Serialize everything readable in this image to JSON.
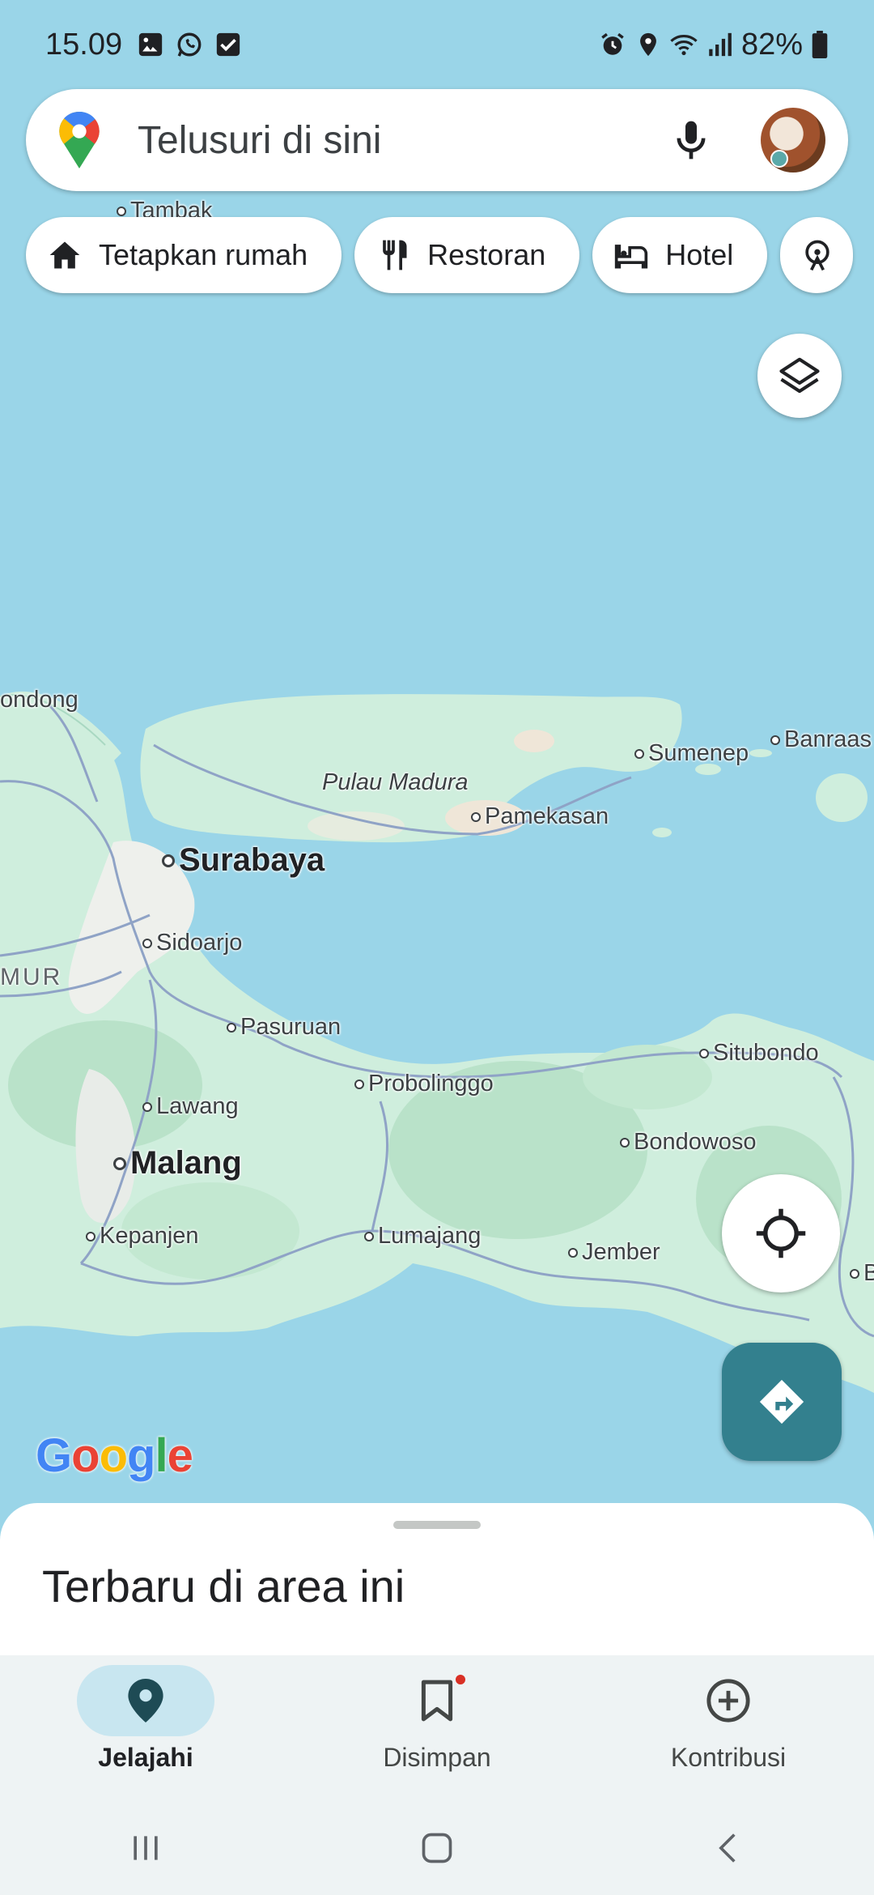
{
  "status_bar": {
    "time": "15.09",
    "battery": "82%",
    "icons": [
      "gallery-icon",
      "whatsapp-icon",
      "checkbox-icon",
      "alarm-icon",
      "location-icon",
      "wifi-icon",
      "signal-icon",
      "battery-icon"
    ]
  },
  "search": {
    "placeholder": "Telusuri di sini"
  },
  "chips": [
    {
      "label": "Tetapkan rumah",
      "icon": "home-icon"
    },
    {
      "label": "Restoran",
      "icon": "restaurant-icon"
    },
    {
      "label": "Hotel",
      "icon": "hotel-icon"
    },
    {
      "label": "",
      "icon": "attraction-icon"
    }
  ],
  "map": {
    "places": {
      "tambak": "Tambak",
      "bondong": "ondong",
      "sumenep": "Sumenep",
      "banraas": "Banraas",
      "pulau_madura": "Pulau Madura",
      "pamekasan": "Pamekasan",
      "surabaya": "Surabaya",
      "sidoarjo": "Sidoarjo",
      "region_mur": "MUR",
      "pasuruan": "Pasuruan",
      "situbondo": "Situbondo",
      "probolinggo": "Probolinggo",
      "lawang": "Lawang",
      "bondowoso": "Bondowoso",
      "malang": "Malang",
      "kepanjen": "Kepanjen",
      "lumajang": "Lumajang",
      "jember": "Jember",
      "edge_b": "B"
    },
    "attribution": "Google"
  },
  "sheet": {
    "title": "Terbaru di area ini"
  },
  "bottom_nav": [
    {
      "label": "Jelajahi",
      "icon": "explore-pin-icon",
      "active": true
    },
    {
      "label": "Disimpan",
      "icon": "bookmark-icon",
      "active": false,
      "badge": true
    },
    {
      "label": "Kontribusi",
      "icon": "add-circle-icon",
      "active": false
    }
  ],
  "colors": {
    "water": "#9ad5e8",
    "land": "#cfeedd",
    "accent": "#33808e",
    "active_pill": "#c8e6f0"
  }
}
